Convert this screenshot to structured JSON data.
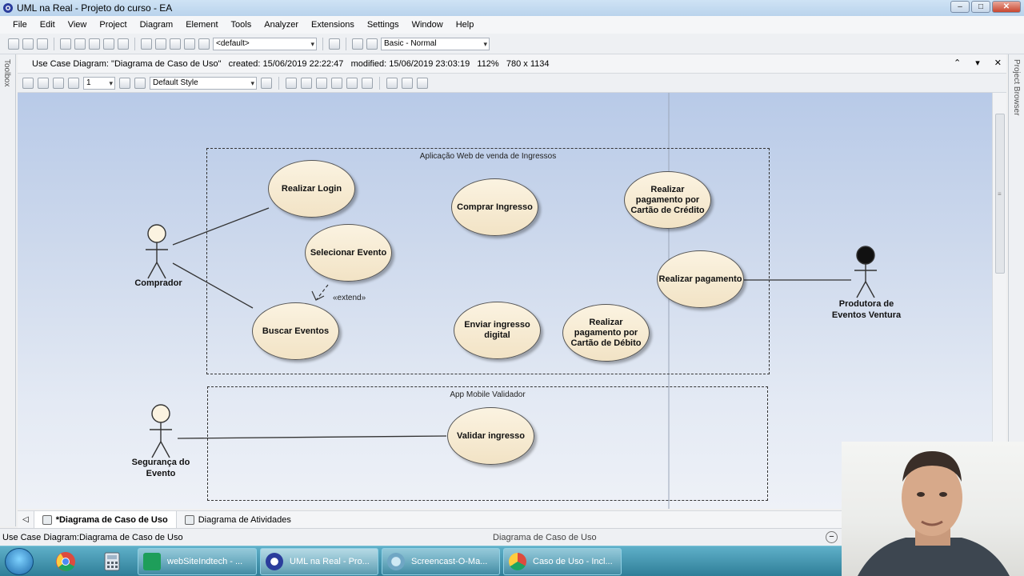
{
  "window": {
    "title": "UML na Real - Projeto do curso - EA",
    "controls": [
      "–",
      "□",
      "✕"
    ]
  },
  "menu": [
    "File",
    "Edit",
    "View",
    "Project",
    "Diagram",
    "Element",
    "Tools",
    "Analyzer",
    "Extensions",
    "Settings",
    "Window",
    "Help"
  ],
  "toolbar": {
    "package_combo": "<default>",
    "workspace_combo": "Basic - Normal"
  },
  "side_panels": {
    "toolbox": "Toolbox",
    "project_browser": "Project Browser"
  },
  "diagram_header": {
    "type": "Use Case Diagram:",
    "name": "\"Diagrama de Caso de Uso\"",
    "created_label": "created:",
    "created": "15/06/2019 22:22:47",
    "modified_label": "modified:",
    "modified": "15/06/2019 23:03:19",
    "zoom": "112%",
    "size": "780 x 1134",
    "controls": [
      "⌃",
      "▾",
      "✕"
    ]
  },
  "format_toolbar": {
    "line_width": "1",
    "style": "Default Style"
  },
  "diagram": {
    "boundaries": [
      {
        "id": "web",
        "label": "Aplicação Web de venda de Ingressos"
      },
      {
        "id": "mobile",
        "label": "App Mobile Validador"
      }
    ],
    "use_cases": [
      {
        "id": "login",
        "label": "Realizar Login"
      },
      {
        "id": "comprar",
        "label": "Comprar Ingresso"
      },
      {
        "id": "cartao_credito",
        "label": "Realizar pagamento por Cartão de Crédito"
      },
      {
        "id": "selecionar",
        "label": "Selecionar Evento"
      },
      {
        "id": "pagamento",
        "label": "Realizar pagamento"
      },
      {
        "id": "buscar",
        "label": "Buscar Eventos"
      },
      {
        "id": "enviar",
        "label": "Enviar ingresso digital"
      },
      {
        "id": "cartao_debito",
        "label": "Realizar pagamento por Cartão de Débito"
      },
      {
        "id": "validar",
        "label": "Validar ingresso"
      }
    ],
    "actors": [
      {
        "id": "comprador",
        "label": "Comprador"
      },
      {
        "id": "produtora",
        "label": "Produtora de Eventos Ventura"
      },
      {
        "id": "seguranca",
        "label": "Segurança do Evento"
      }
    ],
    "extend_label": "«extend»"
  },
  "tabs": [
    {
      "label": "*Diagrama de Caso de Uso",
      "active": true
    },
    {
      "label": "Diagrama de Atividades",
      "active": false
    }
  ],
  "status": {
    "left": "Use Case Diagram:Diagrama de Caso de Uso",
    "center": "Diagrama de Caso de Uso"
  },
  "taskbar": {
    "buttons": [
      {
        "label": "webSiteIndtech - ...",
        "icon": "visual-studio-icon"
      },
      {
        "label": "UML na Real - Pro...",
        "icon": "enterprise-architect-icon"
      },
      {
        "label": "Screencast-O-Ma...",
        "icon": "screencast-icon"
      },
      {
        "label": "Caso de Uso - Incl...",
        "icon": "chrome-icon"
      }
    ]
  }
}
